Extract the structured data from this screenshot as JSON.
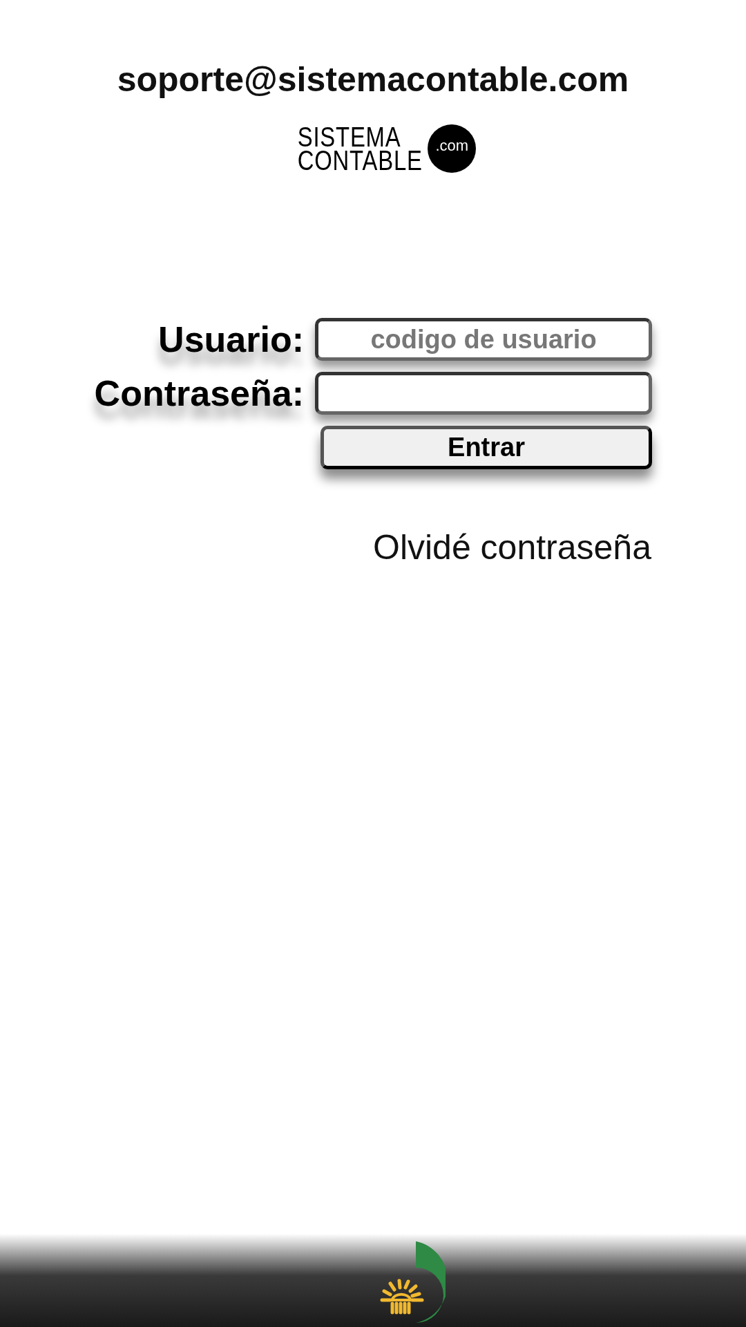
{
  "support_email": "soporte@sistemacontable.com",
  "logo": {
    "line_1": "SISTEMA",
    "line_2": "CONTABLE",
    "badge": ".com"
  },
  "form": {
    "fields": [
      {
        "label": "Usuario:",
        "placeholder": "codigo de usuario"
      },
      {
        "label": "Contraseña:"
      }
    ],
    "submit": "Entrar",
    "forgot_link": "Olvidé contraseña"
  }
}
